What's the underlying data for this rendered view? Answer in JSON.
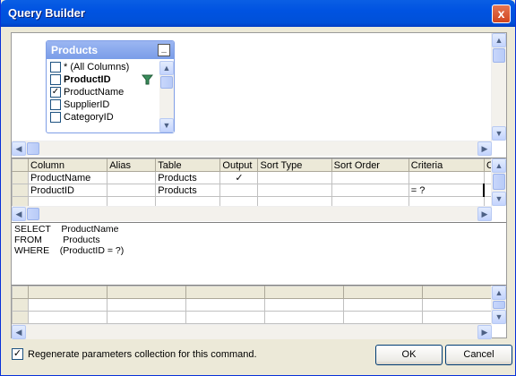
{
  "window": {
    "title": "Query Builder",
    "close_glyph": "x"
  },
  "diagram": {
    "table_title": "Products",
    "minimize_glyph": "_",
    "columns": [
      {
        "label": "* (All Columns)",
        "checked": false,
        "bold": false
      },
      {
        "label": "ProductID",
        "checked": false,
        "bold": true,
        "filter_icon": true
      },
      {
        "label": "ProductName",
        "checked": true,
        "bold": false
      },
      {
        "label": "SupplierID",
        "checked": false,
        "bold": false
      },
      {
        "label": "CategoryID",
        "checked": false,
        "bold": false
      }
    ]
  },
  "grid": {
    "headers": [
      "Column",
      "Alias",
      "Table",
      "Output",
      "Sort Type",
      "Sort Order",
      "Criteria",
      "O"
    ],
    "rows": [
      {
        "column": "ProductName",
        "alias": "",
        "table": "Products",
        "output": "✓",
        "sort_type": "",
        "sort_order": "",
        "criteria": ""
      },
      {
        "column": "ProductID",
        "alias": "",
        "table": "Products",
        "output": "",
        "sort_type": "",
        "sort_order": "",
        "criteria": "= ?"
      }
    ]
  },
  "sql": {
    "line1": "SELECT    ProductName",
    "line2": "FROM        Products",
    "line3": "WHERE    (ProductID = ?)"
  },
  "footer": {
    "regenerate_label": "Regenerate parameters collection for this command.",
    "regenerate_checked": true,
    "ok_label": "OK",
    "cancel_label": "Cancel"
  },
  "colors": {
    "title_blue": "#0053e1",
    "pane_header_blue": "#7f9ee6",
    "border_blue": "#7f9db9"
  }
}
